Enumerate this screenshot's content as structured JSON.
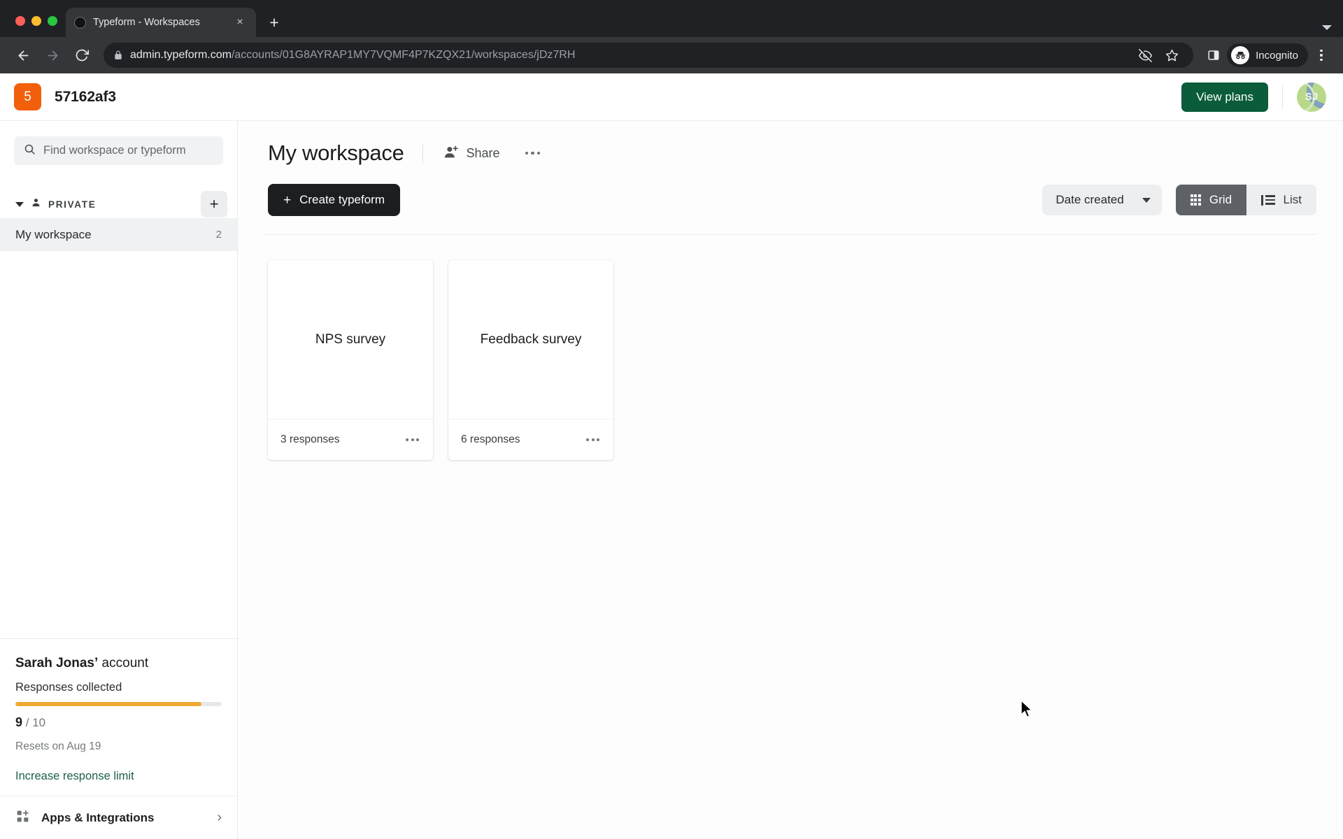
{
  "browser": {
    "tab": {
      "title": "Typeform - Workspaces",
      "favicon": "typeform-favicon",
      "close": "×"
    },
    "new_tab_label": "+",
    "url": {
      "domain": "admin.typeform.com",
      "path": "/accounts/01G8AYRAP1MY7VQMF4P7KZQX21/workspaces/jDz7RH"
    },
    "profile_label": "Incognito",
    "icons": {
      "back": "back-arrow-icon",
      "forward": "forward-arrow-icon",
      "reload": "reload-icon",
      "lock": "lock-icon",
      "tracking_protection": "eye-slash-icon",
      "bookmark": "star-icon",
      "side_panel": "side-panel-icon",
      "menu": "three-dot-menu-icon"
    }
  },
  "app_header": {
    "workspace_logo_text": "5",
    "account_name": "57162af3",
    "view_plans_label": "View plans",
    "avatar_initials": "SJ",
    "logo_color": "#f2600c",
    "view_plans_color": "#0a5c3a"
  },
  "sidebar": {
    "search": {
      "placeholder": "Find workspace or typeform",
      "value": ""
    },
    "private_section": {
      "label": "PRIVATE",
      "add_label": "+"
    },
    "workspaces": [
      {
        "label": "My workspace",
        "count": "2",
        "selected": true
      }
    ],
    "account_panel": {
      "owner": "Sarah Jonas’",
      "owner_suffix": " account",
      "responses_label": "Responses collected",
      "used": "9",
      "limit": "/ 10",
      "progress_percent": 90,
      "progress_color": "#efa832",
      "resets": "Resets on Aug 19",
      "increase_link": "Increase response limit",
      "link_color": "#1c6049"
    },
    "apps_row": {
      "label": "Apps & Integrations",
      "chevron": "›"
    }
  },
  "main": {
    "workspace_title": "My workspace",
    "share_label": "Share",
    "create_label": "Create typeform",
    "create_plus": "+",
    "sort": {
      "label": "Date created"
    },
    "view": {
      "grid_label": "Grid",
      "list_label": "List",
      "active": "Grid"
    },
    "typeforms": [
      {
        "name": "NPS survey",
        "responses": "3 responses"
      },
      {
        "name": "Feedback survey",
        "responses": "6 responses"
      }
    ]
  }
}
